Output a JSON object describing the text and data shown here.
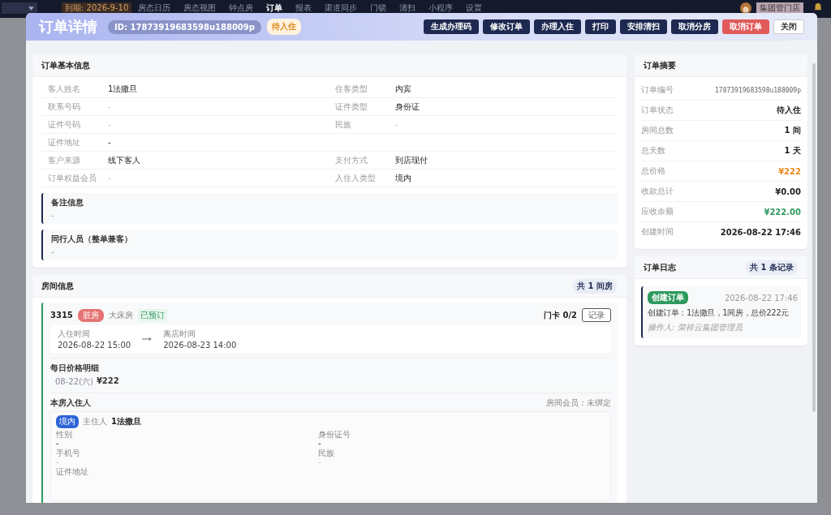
{
  "nav": {
    "expiry": "到期: 2026-9-10",
    "items": [
      {
        "label": "房态日历",
        "selected": false
      },
      {
        "label": "房态视图",
        "selected": false
      },
      {
        "label": "钟点房",
        "selected": false
      },
      {
        "label": "订单",
        "selected": true
      },
      {
        "label": "报表",
        "selected": false
      },
      {
        "label": "渠道同步",
        "selected": false
      },
      {
        "label": "门锁",
        "selected": false
      },
      {
        "label": "清扫",
        "selected": false
      },
      {
        "label": "小程序",
        "selected": false
      },
      {
        "label": "设置",
        "selected": false
      }
    ],
    "store": "集团管门店"
  },
  "modal": {
    "title": "订单详情",
    "order_id": "ID: 17873919683598u188009p",
    "status": "待入住",
    "buttons": [
      {
        "label": "生成办理码",
        "kind": "primary"
      },
      {
        "label": "修改订单",
        "kind": "primary"
      },
      {
        "label": "办理入住",
        "kind": "primary"
      },
      {
        "label": "打印",
        "kind": "primary"
      },
      {
        "label": "安排清扫",
        "kind": "primary"
      },
      {
        "label": "取消分房",
        "kind": "primary"
      },
      {
        "label": "取消订单",
        "kind": "danger"
      },
      {
        "label": "关闭",
        "kind": "plain"
      }
    ]
  },
  "basic_info": {
    "title": "订单基本信息",
    "rows": [
      {
        "left": {
          "label": "客人姓名",
          "value": "1法撒旦",
          "muted": false
        },
        "right": {
          "label": "住客类型",
          "value": "内宾",
          "muted": false
        }
      },
      {
        "left": {
          "label": "联系号码",
          "value": "-",
          "muted": true
        },
        "right": {
          "label": "证件类型",
          "value": "身份证",
          "muted": false
        }
      },
      {
        "left": {
          "label": "证件号码",
          "value": "-",
          "muted": true
        },
        "right": {
          "label": "民族",
          "value": "-",
          "muted": true
        }
      },
      {
        "left": {
          "label": "证件地址",
          "value": "-",
          "muted": false
        }
      },
      {
        "left": {
          "label": "客户来源",
          "value": "线下客人",
          "muted": false
        },
        "right": {
          "label": "支付方式",
          "value": "到店现付",
          "muted": false
        }
      },
      {
        "left": {
          "label": "订单权益会员",
          "value": "-",
          "muted": true
        },
        "right": {
          "label": "入住人类型",
          "value": "境内",
          "muted": false
        }
      }
    ],
    "notes": [
      {
        "title": "备注信息",
        "value": "-"
      },
      {
        "title": "同行人员（整单兼客）",
        "value": "-"
      }
    ]
  },
  "rooms": {
    "title": "房间信息",
    "count": "共 1 间房",
    "room": {
      "number": "3315",
      "state": "脏房",
      "type": "大床房",
      "booking": "已预订",
      "card": "门卡 0/2",
      "record_button": "记录",
      "checkin_label": "入住时间",
      "checkin": "2026-08-22 15:00",
      "checkout_label": "离店时间",
      "checkout": "2026-08-23 14:00",
      "price_title": "每日价格明细",
      "prices": [
        {
          "date": "08-22(六)",
          "price": "¥222"
        }
      ],
      "guests_title": "本房入住人",
      "binding": "房间会员：未绑定",
      "guest": {
        "tag": "境内",
        "role": "主住人",
        "name": "1法撒旦",
        "fields": [
          {
            "label": "性别",
            "value": "-",
            "muted": false
          },
          {
            "label": "身份证号",
            "value": "-",
            "muted": false
          },
          {
            "label": "手机号",
            "value": "-",
            "muted": true
          },
          {
            "label": "民族",
            "value": "-",
            "muted": true
          },
          {
            "label": "证件地址"
          }
        ]
      }
    }
  },
  "summary": {
    "title": "订单摘要",
    "items": [
      {
        "label": "订单编号",
        "value": "17873919683598u188009p",
        "kind": "code",
        "color": "#666666"
      },
      {
        "label": "订单状态",
        "value": "待入住",
        "kind": "text",
        "color": "#222222"
      },
      {
        "label": "房间总数",
        "value": "1 间",
        "kind": "text",
        "color": "#222222"
      },
      {
        "label": "总天数",
        "value": "1 天",
        "kind": "text",
        "color": "#222222"
      },
      {
        "label": "总价格",
        "value": "¥222",
        "kind": "text",
        "color": "#e88a1a"
      },
      {
        "label": "收款总计",
        "value": "¥0.00",
        "kind": "text",
        "color": "#222222"
      },
      {
        "label": "应收余额",
        "value": "¥222.00",
        "kind": "text",
        "color": "#2e9a5e"
      },
      {
        "label": "创建时间",
        "value": "2026-08-22 17:46",
        "kind": "text",
        "color": "#222222"
      }
    ]
  },
  "log": {
    "title": "订单日志",
    "count": "共 1 条记录",
    "entries": [
      {
        "tag": "创建订单",
        "time": "2026-08-22 17:46",
        "text": "创建订单：1法撒旦，1间房，总价222元",
        "operator": "操作人: 荣祥云集团管理员"
      }
    ]
  }
}
